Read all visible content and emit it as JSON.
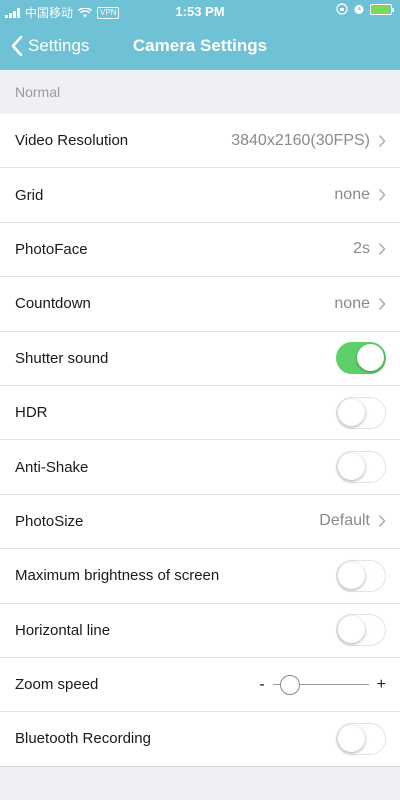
{
  "status_bar": {
    "carrier": "中国移动",
    "vpn": "VPN",
    "time": "1:53 PM"
  },
  "navbar": {
    "back_label": "Settings",
    "title": "Camera Settings"
  },
  "section": {
    "title": "Normal"
  },
  "rows": [
    {
      "label": "Video Resolution",
      "type": "value",
      "value": "3840x2160(30FPS)"
    },
    {
      "label": "Grid",
      "type": "value",
      "value": "none"
    },
    {
      "label": "PhotoFace",
      "type": "value",
      "value": "2s"
    },
    {
      "label": "Countdown",
      "type": "value",
      "value": "none"
    },
    {
      "label": "Shutter sound",
      "type": "toggle",
      "on": true
    },
    {
      "label": "HDR",
      "type": "toggle",
      "on": false
    },
    {
      "label": "Anti-Shake",
      "type": "toggle",
      "on": false
    },
    {
      "label": "PhotoSize",
      "type": "value",
      "value": "Default"
    },
    {
      "label": "Maximum brightness of screen",
      "type": "toggle",
      "on": false
    },
    {
      "label": "Horizontal line",
      "type": "toggle",
      "on": false
    },
    {
      "label": "Zoom speed",
      "type": "slider",
      "minus": "-",
      "plus": "+",
      "level": 0.1
    },
    {
      "label": "Bluetooth Recording",
      "type": "toggle",
      "on": false
    }
  ],
  "colors": {
    "header": "#6fc1d6",
    "toggle_on": "#5ed06a",
    "background": "#efeff4"
  }
}
